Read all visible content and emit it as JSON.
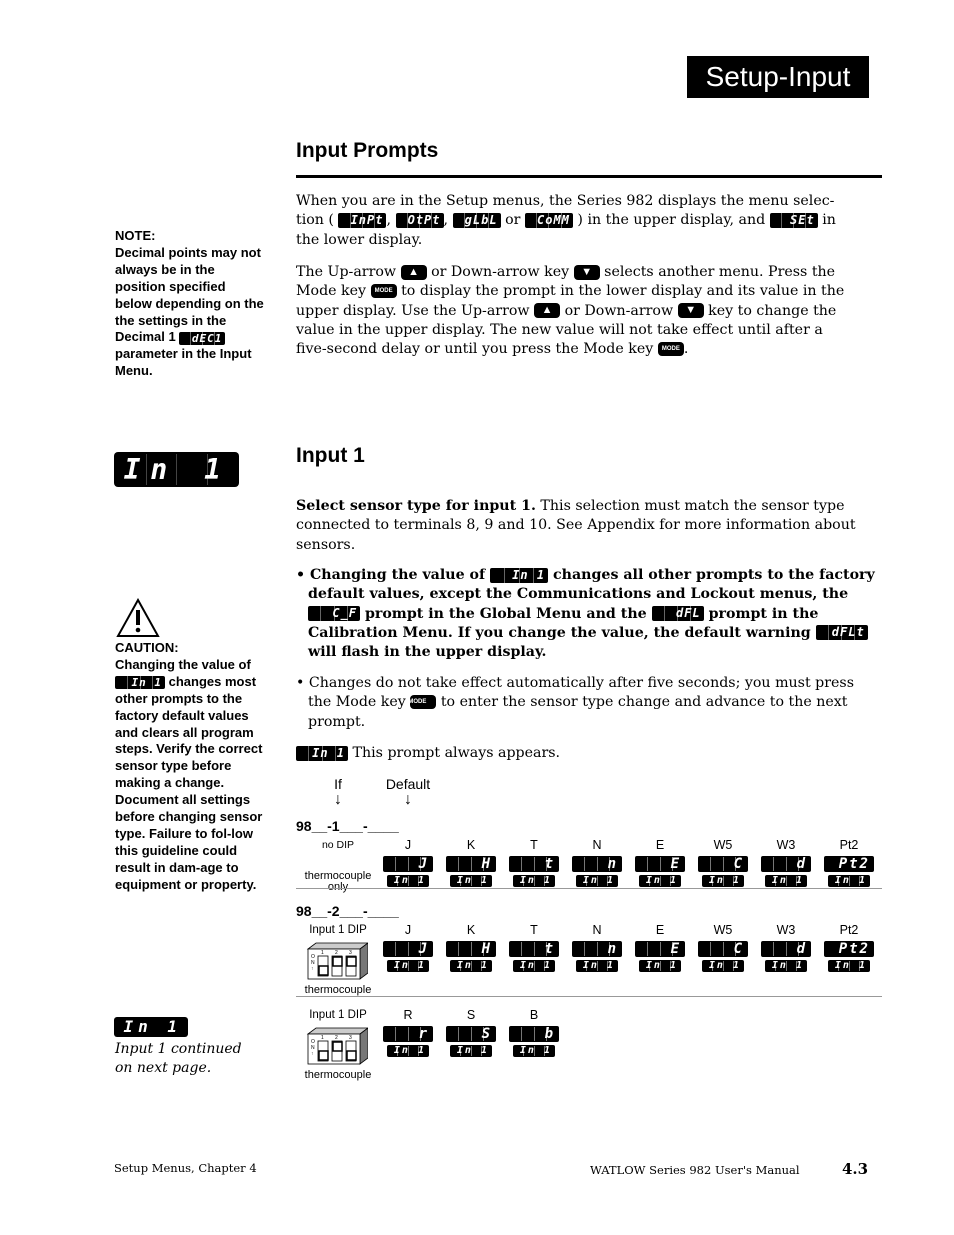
{
  "header": {
    "section_title": "Setup-Input"
  },
  "input_prompts": {
    "heading": "Input Prompts",
    "para1": {
      "t1": "When you are in the Setup menus, the Series 982 displays the menu selec-",
      "t2": "tion (",
      "menus": [
        "InPt",
        "OtPt",
        "gLbL",
        "CoMM"
      ],
      "sep1": ",",
      "sep2": ",",
      "or": "or",
      "t3": ") in the upper display, and",
      "set_display": "SEt",
      "t4": "in",
      "t5": "the lower display."
    },
    "para2": {
      "t1": "The Up-arrow",
      "t2": "or Down-arrow key",
      "t3": "selects another menu. Press the",
      "t4": "Mode key",
      "t5": "to display the prompt in the lower display and its value in the",
      "t6": "upper display. Use the Up-arrow",
      "t7": "or Down-arrow",
      "t8": "key to change the",
      "t9": "value in the upper display. The new value will not take effect until after a",
      "t10": "five-second delay or until you press the Mode key",
      "t11": ".",
      "up_icon": "▲",
      "down_icon": "▼",
      "mode_label": "MODE"
    }
  },
  "note": {
    "label": "NOTE:",
    "text1": "Decimal points may not always be in the position specified below depending on the the settings in the Decimal 1",
    "display": "dEC1",
    "text2": "parameter in the Input Menu."
  },
  "input1": {
    "side_display": "In 1",
    "heading": "Input 1",
    "intro_bold": "Select sensor type for input 1.",
    "intro_rest": " This selection must match the sensor type connected to terminals 8, 9 and 10. See Appendix for more information about sensors.",
    "bullet1": {
      "t1": "• Changing the value of",
      "d1": "In 1",
      "t2": "changes all other prompts to the factory default values, except the Communications and Lockout menus, the",
      "d2": "C_F",
      "t3": "prompt in the Global Menu and the",
      "d3": "dFL",
      "t4": "prompt in the Calibration Menu. If you change the value, the default warning",
      "d4": "dFLt",
      "t5": "will flash in the upper display."
    },
    "bullet2": {
      "t1": "• Changes do not take effect automatically after five seconds; you must press the Mode key",
      "mode_label": "MODE",
      "t2": "to enter the sensor type change and advance to the next prompt."
    },
    "always": {
      "display": "In 1",
      "text": "This prompt always appears."
    },
    "continued": {
      "display": "In 1",
      "text": "Input 1 continued on next page."
    }
  },
  "caution": {
    "label": "CAUTION:",
    "t1": "Changing the value of",
    "display": "In 1",
    "t2": "changes most other prompts to the factory default values and clears all program steps. Verify the correct sensor type before making a change. Document all settings before changing sensor type. Failure to fol-low this guideline could result in dam-age to equipment or property."
  },
  "table": {
    "if_label": "If",
    "default_label": "Default",
    "arrow": "↓",
    "groups": [
      {
        "model": "98__-1___-____",
        "dip_label": "no DIP",
        "foot_label": "thermocouple only",
        "has_dip": false,
        "sensors": [
          {
            "name": "J",
            "upper": "J",
            "lower": "In 1"
          },
          {
            "name": "K",
            "upper": "H",
            "lower": "In 1"
          },
          {
            "name": "T",
            "upper": "t",
            "lower": "In 1"
          },
          {
            "name": "N",
            "upper": "n",
            "lower": "In 1"
          },
          {
            "name": "E",
            "upper": "E",
            "lower": "In 1"
          },
          {
            "name": "W5",
            "upper": "C",
            "lower": "In 1"
          },
          {
            "name": "W3",
            "upper": "d",
            "lower": "In 1"
          },
          {
            "name": "Pt2",
            "upper": "Pt2",
            "lower": "In 1"
          }
        ]
      },
      {
        "model": "98__-2___-____",
        "dip_label": "Input 1 DIP",
        "foot_label": "thermocouple",
        "has_dip": true,
        "dip_positions": [
          "off",
          "on",
          "on"
        ],
        "sensors": [
          {
            "name": "J",
            "upper": "J",
            "lower": "In 1"
          },
          {
            "name": "K",
            "upper": "H",
            "lower": "In 1"
          },
          {
            "name": "T",
            "upper": "t",
            "lower": "In 1"
          },
          {
            "name": "N",
            "upper": "n",
            "lower": "In 1"
          },
          {
            "name": "E",
            "upper": "E",
            "lower": "In 1"
          },
          {
            "name": "W5",
            "upper": "C",
            "lower": "In 1"
          },
          {
            "name": "W3",
            "upper": "d",
            "lower": "In 1"
          },
          {
            "name": "Pt2",
            "upper": "Pt2",
            "lower": "In 1"
          }
        ]
      },
      {
        "model": "",
        "dip_label": "Input 1 DIP",
        "foot_label": "thermocouple",
        "has_dip": true,
        "dip_positions": [
          "off",
          "on",
          "off"
        ],
        "sensors": [
          {
            "name": "R",
            "upper": "r",
            "lower": "In 1"
          },
          {
            "name": "S",
            "upper": "S",
            "lower": "In 1"
          },
          {
            "name": "B",
            "upper": "b",
            "lower": "In 1"
          }
        ]
      }
    ]
  },
  "footer": {
    "left": "Setup Menus, Chapter 4",
    "manual": "WATLOW Series 982 User's Manual",
    "page": "4.3"
  }
}
